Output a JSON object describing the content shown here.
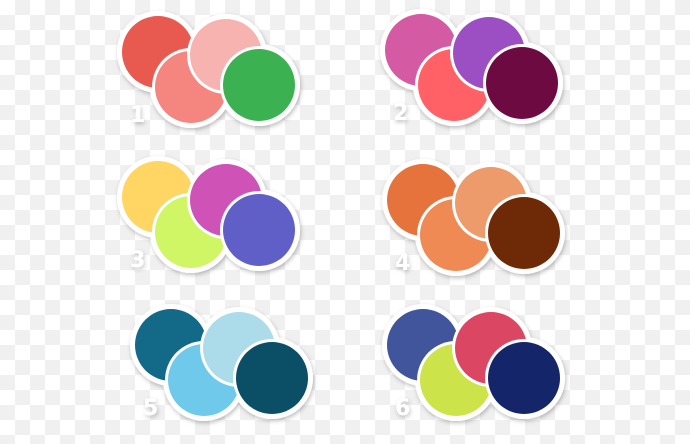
{
  "palettes": [
    {
      "label": "1",
      "colors": [
        "#e85a4f",
        "#f4857f",
        "#f7b3b0",
        "#3cb152"
      ]
    },
    {
      "label": "2",
      "colors": [
        "#d35aa3",
        "#ff6167",
        "#9c4fc3",
        "#6e0a42"
      ]
    },
    {
      "label": "3",
      "colors": [
        "#ffd563",
        "#d0f565",
        "#cf52b6",
        "#5f5fc7"
      ]
    },
    {
      "label": "4",
      "colors": [
        "#e6733c",
        "#ef8a55",
        "#ee9b6b",
        "#6e2a07"
      ]
    },
    {
      "label": "5",
      "colors": [
        "#136a88",
        "#6ec9ea",
        "#acdbea",
        "#0a4f66"
      ]
    },
    {
      "label": "6",
      "colors": [
        "#40559c",
        "#cde34a",
        "#db4762",
        "#15256a"
      ]
    }
  ]
}
